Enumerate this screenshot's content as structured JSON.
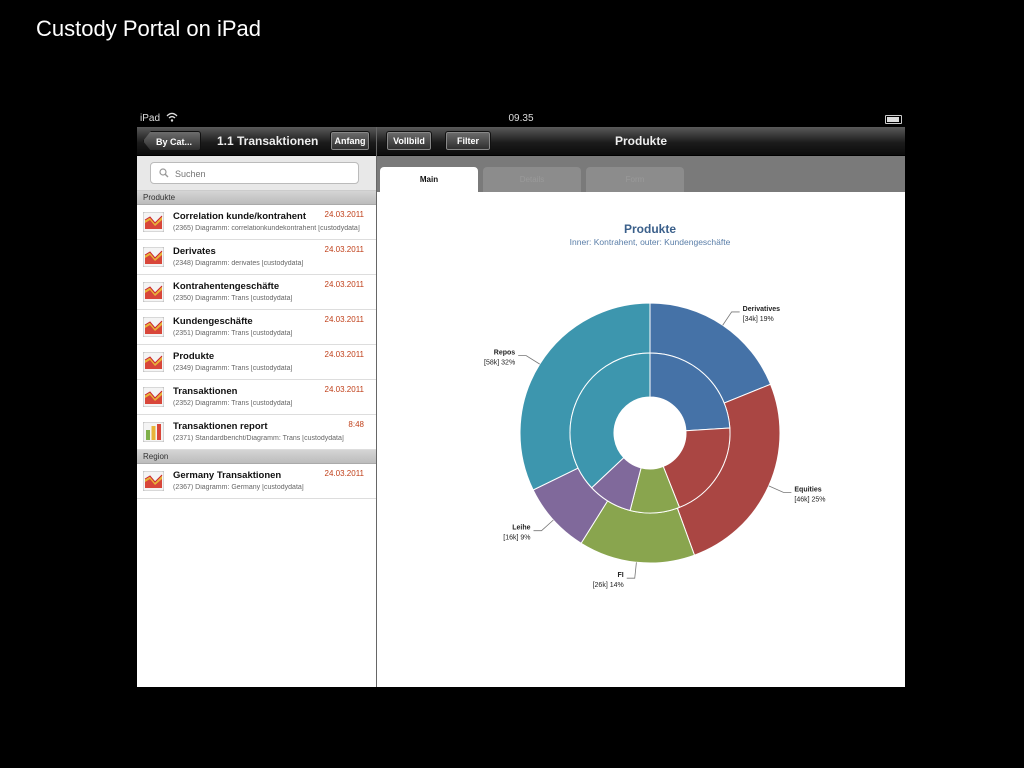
{
  "slide_title": "Custody Portal on iPad",
  "status_bar": {
    "device": "iPad",
    "time": "09.35"
  },
  "master": {
    "back_button": "By Cat...",
    "title": "1.1 Transaktionen",
    "right_button": "Anfang",
    "search": {
      "placeholder": "Suchen"
    },
    "sections": [
      {
        "header": "Produkte",
        "items": [
          {
            "title": "Correlation kunde/kontrahent",
            "date": "24.03.2011",
            "subtitle": "(2365) Diagramm: correlationkundekontrahent [custodydata]",
            "icon": "pie-report-icon"
          },
          {
            "title": "Derivates",
            "date": "24.03.2011",
            "subtitle": "(2348) Diagramm: derivates [custodydata]",
            "icon": "pie-report-icon"
          },
          {
            "title": "Kontrahentengeschäfte",
            "date": "24.03.2011",
            "subtitle": "(2350) Diagramm: Trans [custodydata]",
            "icon": "pie-report-icon"
          },
          {
            "title": "Kundengeschäfte",
            "date": "24.03.2011",
            "subtitle": "(2351) Diagramm: Trans [custodydata]",
            "icon": "pie-report-icon"
          },
          {
            "title": "Produkte",
            "date": "24.03.2011",
            "subtitle": "(2349) Diagramm: Trans [custodydata]",
            "icon": "pie-report-icon"
          },
          {
            "title": "Transaktionen",
            "date": "24.03.2011",
            "subtitle": "(2352) Diagramm: Trans [custodydata]",
            "icon": "pie-report-icon"
          },
          {
            "title": "Transaktionen report",
            "date": "8:48",
            "subtitle": "(2371) Standardbericht/Diagramm: Trans [custodydata]",
            "icon": "bar-report-icon"
          }
        ]
      },
      {
        "header": "Region",
        "items": [
          {
            "title": "Germany Transaktionen",
            "date": "24.03.2011",
            "subtitle": "(2367) Diagramm: Germany [custodydata]",
            "icon": "pie-report-icon"
          }
        ]
      }
    ]
  },
  "detail": {
    "buttons": [
      "Vollbild",
      "Filter"
    ],
    "title": "Produkte",
    "tabs": [
      {
        "label": "Main",
        "active": true
      },
      {
        "label": "Details",
        "active": false
      },
      {
        "label": "Form",
        "active": false
      }
    ]
  },
  "chart_data": {
    "type": "pie",
    "title": "Produkte",
    "subtitle": "Inner: Kontrahent, outer: Kundengeschäfte",
    "outer": [
      {
        "name": "Derivatives",
        "value": 34,
        "value_label": "[34k]",
        "percent": 19,
        "color": "#4572a7"
      },
      {
        "name": "Equities",
        "value": 46,
        "value_label": "[46k]",
        "percent": 25,
        "color": "#aa4643"
      },
      {
        "name": "FI",
        "value": 26,
        "value_label": "[26k]",
        "percent": 14,
        "color": "#89a54e"
      },
      {
        "name": "Leihe",
        "value": 16,
        "value_label": "[16k]",
        "percent": 9,
        "color": "#80699b"
      },
      {
        "name": "Repos",
        "value": 58,
        "value_label": "[58k]",
        "percent": 32,
        "color": "#3d96ae"
      }
    ],
    "inner": [
      {
        "name": "Derivatives",
        "percent": 24,
        "color": "#4572a7"
      },
      {
        "name": "Equities",
        "percent": 20,
        "color": "#aa4643"
      },
      {
        "name": "FI",
        "percent": 10,
        "color": "#89a54e"
      },
      {
        "name": "Leihe",
        "percent": 9,
        "color": "#80699b"
      },
      {
        "name": "Repos",
        "percent": 37,
        "color": "#3d96ae"
      }
    ]
  }
}
